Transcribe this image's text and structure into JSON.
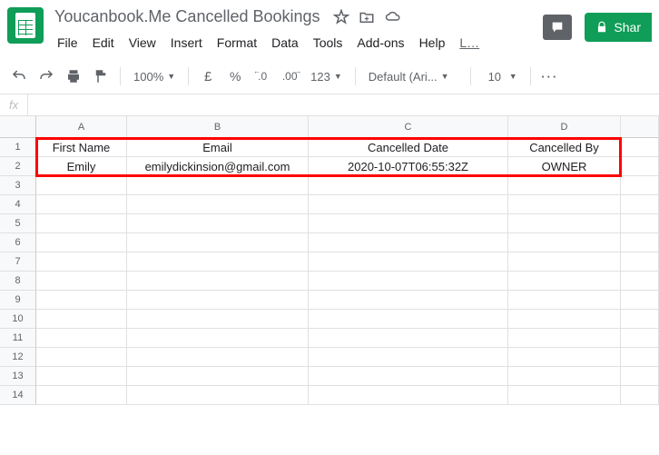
{
  "doc": {
    "title": "Youcanbook.Me Cancelled Bookings"
  },
  "menu": {
    "file": "File",
    "edit": "Edit",
    "view": "View",
    "insert": "Insert",
    "format": "Format",
    "data": "Data",
    "tools": "Tools",
    "addons": "Add-ons",
    "help": "Help",
    "last": "L…"
  },
  "share": {
    "label": "Shar"
  },
  "toolbar": {
    "zoom": "100%",
    "currency": "£",
    "percent": "%",
    "dec1": ".0",
    "dec2": ".00",
    "more": "123",
    "font": "Default (Ari...",
    "fontsize": "10"
  },
  "fx": {
    "label": "fx"
  },
  "cols": {
    "a": "A",
    "b": "B",
    "c": "C",
    "d": "D"
  },
  "rows": [
    "1",
    "2",
    "3",
    "4",
    "5",
    "6",
    "7",
    "8",
    "9",
    "10",
    "11",
    "12",
    "13",
    "14"
  ],
  "sheet": {
    "r1": {
      "a": "First Name",
      "b": "Email",
      "c": "Cancelled Date",
      "d": "Cancelled By"
    },
    "r2": {
      "a": "Emily",
      "b": "emilydickinsion@gmail.com",
      "c": "2020-10-07T06:55:32Z",
      "d": "OWNER"
    }
  }
}
